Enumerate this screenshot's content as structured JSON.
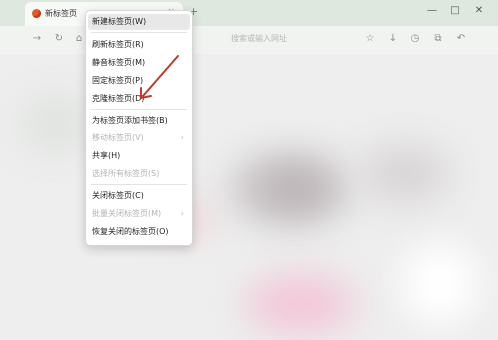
{
  "tab": {
    "title": "新标签页",
    "close_glyph": "×",
    "new_glyph": "+"
  },
  "window": {
    "minimize_glyph": "—",
    "maximize_glyph": "□",
    "close_glyph": "✕"
  },
  "address": {
    "text": "搜索或输入网址"
  },
  "menu": {
    "items": [
      {
        "label": "新建标签页(W)",
        "disabled": false
      },
      {
        "label": "刷新标签页(R)",
        "disabled": false
      },
      {
        "label": "静音标签页(M)",
        "disabled": false
      },
      {
        "label": "固定标签页(P)",
        "disabled": false
      },
      {
        "label": "克隆标签页(D)",
        "disabled": false
      },
      {
        "label": "为标签页添加书签(B)",
        "disabled": false
      },
      {
        "label": "移动标签页(V)",
        "disabled": true,
        "submenu": true
      },
      {
        "label": "共享(H)",
        "disabled": false
      },
      {
        "label": "选择所有标签页(S)",
        "disabled": true
      },
      {
        "label": "关闭标签页(C)",
        "disabled": false
      },
      {
        "label": "批量关闭标签页(M)",
        "disabled": true,
        "submenu": true
      },
      {
        "label": "恢复关闭的标签页(O)",
        "disabled": false
      }
    ],
    "submenu_glyph": "›"
  },
  "colors": {
    "annotation_arrow": "#c0392b",
    "tab_favicon": "#e55a1f"
  },
  "icons": [
    "back-icon",
    "reload-icon",
    "home-icon",
    "star-icon",
    "download-icon",
    "history-icon",
    "extensions-icon",
    "undo-icon"
  ]
}
